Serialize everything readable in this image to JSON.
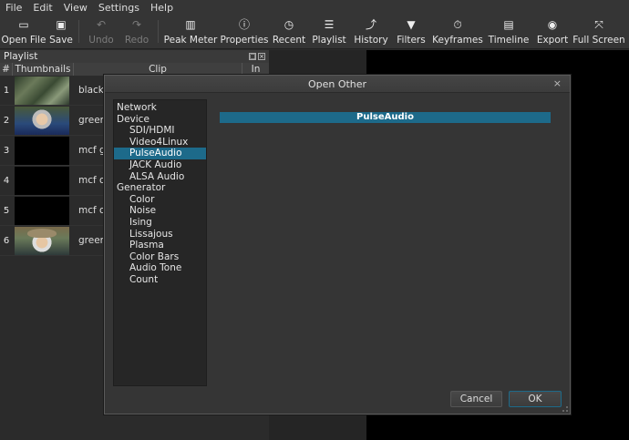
{
  "menu": [
    "File",
    "Edit",
    "View",
    "Settings",
    "Help"
  ],
  "toolbar": [
    {
      "label": "Open File",
      "icon": "open-file-icon",
      "glyph": "▭",
      "enabled": true
    },
    {
      "label": "Save",
      "icon": "save-icon",
      "glyph": "▣",
      "enabled": true
    },
    {
      "label": "Undo",
      "icon": "undo-icon",
      "glyph": "↶",
      "enabled": false
    },
    {
      "label": "Redo",
      "icon": "redo-icon",
      "glyph": "↷",
      "enabled": false
    },
    {
      "label": "Peak Meter",
      "icon": "peak-meter-icon",
      "glyph": "▥",
      "enabled": true
    },
    {
      "label": "Properties",
      "icon": "properties-icon",
      "glyph": "ⓘ",
      "enabled": true
    },
    {
      "label": "Recent",
      "icon": "recent-icon",
      "glyph": "◷",
      "enabled": true
    },
    {
      "label": "Playlist",
      "icon": "playlist-icon",
      "glyph": "☰",
      "enabled": true
    },
    {
      "label": "History",
      "icon": "history-icon",
      "glyph": "⤴",
      "enabled": true
    },
    {
      "label": "Filters",
      "icon": "filters-icon",
      "glyph": "▼",
      "enabled": true
    },
    {
      "label": "Keyframes",
      "icon": "keyframes-icon",
      "glyph": "⏱",
      "enabled": true
    },
    {
      "label": "Timeline",
      "icon": "timeline-icon",
      "glyph": "▤",
      "enabled": true
    },
    {
      "label": "Export",
      "icon": "export-icon",
      "glyph": "◉",
      "enabled": true
    },
    {
      "label": "Full Screen",
      "icon": "full-screen-icon",
      "glyph": "⤧",
      "enabled": true
    }
  ],
  "playlist": {
    "title": "Playlist",
    "columns": [
      "#",
      "Thumbnails",
      "Clip",
      "In"
    ],
    "rows": [
      {
        "num": "1",
        "clip": "blacko",
        "thumb": "forest"
      },
      {
        "num": "2",
        "clip": "greenh",
        "thumb": "man"
      },
      {
        "num": "3",
        "clip": "mcf go",
        "thumb": "black"
      },
      {
        "num": "4",
        "clip": "mcf ou",
        "thumb": "black"
      },
      {
        "num": "5",
        "clip": "mcf ou",
        "thumb": "black"
      },
      {
        "num": "6",
        "clip": "greenh",
        "thumb": "man2"
      }
    ]
  },
  "dialog": {
    "title": "Open Other",
    "close": "×",
    "selected_label": "PulseAudio",
    "tree": [
      {
        "label": "Network",
        "level": 0
      },
      {
        "label": "Device",
        "level": 0
      },
      {
        "label": "SDI/HDMI",
        "level": 1
      },
      {
        "label": "Video4Linux",
        "level": 1
      },
      {
        "label": "PulseAudio",
        "level": 1,
        "selected": true
      },
      {
        "label": "JACK Audio",
        "level": 1
      },
      {
        "label": "ALSA Audio",
        "level": 1
      },
      {
        "label": "Generator",
        "level": 0
      },
      {
        "label": "Color",
        "level": 1
      },
      {
        "label": "Noise",
        "level": 1
      },
      {
        "label": "Ising",
        "level": 1
      },
      {
        "label": "Lissajous",
        "level": 1
      },
      {
        "label": "Plasma",
        "level": 1
      },
      {
        "label": "Color Bars",
        "level": 1
      },
      {
        "label": "Audio Tone",
        "level": 1
      },
      {
        "label": "Count",
        "level": 1
      }
    ],
    "cancel_label": "Cancel",
    "ok_label": "OK"
  },
  "colors": {
    "accent": "#1d6a8a",
    "background": "#2b2b2b"
  }
}
